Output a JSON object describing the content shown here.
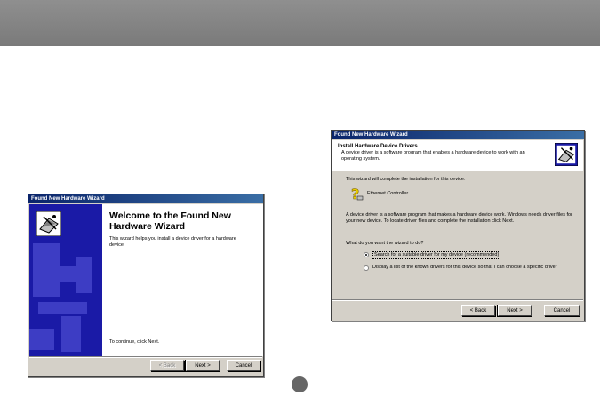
{
  "wizard_welcome": {
    "title": "Found New Hardware Wizard",
    "heading": "Welcome to the Found New Hardware Wizard",
    "subtitle": "This wizard helps you install a device driver for a hardware device.",
    "continue_text": "To continue, click Next.",
    "buttons": {
      "back": "< Back",
      "next": "Next >",
      "cancel": "Cancel"
    }
  },
  "wizard_install": {
    "title": "Found New Hardware Wizard",
    "header_title": "Install Hardware Device Drivers",
    "header_desc": "A device driver is a software program that enables a hardware device to work with an operating system.",
    "intro": "This wizard will complete the installation for this device:",
    "device_name": "Ethernet Controller",
    "explain": "A device driver is a software program that makes a hardware device work. Windows needs driver files for your new device. To locate driver files and complete the installation click Next.",
    "question": "What do you want the wizard to do?",
    "options": [
      {
        "label": "Search for a suitable driver for my device (recommended)",
        "selected": true
      },
      {
        "label": "Display a list of the known drivers for this device so that I can choose a specific driver",
        "selected": false
      }
    ],
    "buttons": {
      "back": "< Back",
      "next": "Next >",
      "cancel": "Cancel"
    }
  },
  "colors": {
    "titlebar": "#0a246a",
    "wizard_panel": "#1a1aa6",
    "top_bar": "#858585"
  }
}
